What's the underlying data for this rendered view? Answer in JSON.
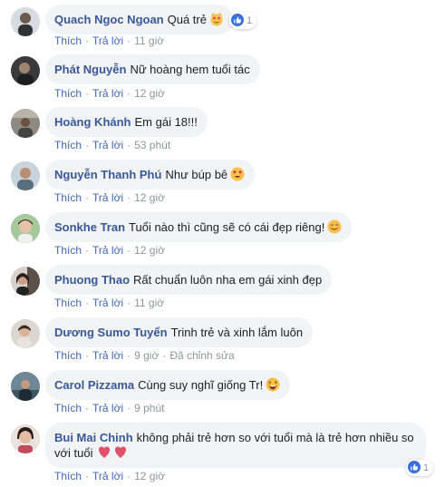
{
  "comments": [
    {
      "author": "Quach Ngoc Ngoan",
      "text": "Quá trẻ",
      "emoji": "cat-heart-eyes-icon",
      "reactions": "1",
      "like": "Thích",
      "reply": "Trả lời",
      "time": "11 giờ"
    },
    {
      "author": "Phát Nguyễn",
      "text": "Nữ hoàng hem tuổi tác",
      "like": "Thích",
      "reply": "Trả lời",
      "time": "12 giờ"
    },
    {
      "author": "Hoàng Khánh",
      "text": "Em gái 18!!!",
      "like": "Thích",
      "reply": "Trả lời",
      "time": "53 phút"
    },
    {
      "author": "Nguyễn Thanh Phú",
      "text": "Như búp bê",
      "emoji": "heart-eyes-emoji-icon",
      "like": "Thích",
      "reply": "Trả lời",
      "time": "12 giờ"
    },
    {
      "author": "Sonkhe Tran",
      "text": "Tuổi nào thì cũng sẽ có cái đẹp riêng!",
      "emoji": "smile-emoji-icon",
      "like": "Thích",
      "reply": "Trả lời",
      "time": "12 giờ"
    },
    {
      "author": "Phuong Thao",
      "text": "Rất chuẩn luôn nha em gái xinh đẹp",
      "like": "Thích",
      "reply": "Trả lời",
      "time": "11 giờ"
    },
    {
      "author": "Dương Sumo Tuyển",
      "text": "Trinh trẻ và xinh lắm luôn",
      "like": "Thích",
      "reply": "Trả lời",
      "time": "9 giờ",
      "edited": "Đã chỉnh sửa"
    },
    {
      "author": "Carol Pizzama",
      "text": "Cùng suy nghĩ giống Tr!",
      "emoji": "laughing-emoji-icon",
      "like": "Thích",
      "reply": "Trả lời",
      "time": "9 phút"
    },
    {
      "author": "Bui Mai Chinh",
      "text_line1": "không phải trẻ hơn so với tuổi mà là trẻ hơn nhiều so",
      "text_line2": "với tuổi",
      "emoji": "two-hearts-icon",
      "reactions": "1",
      "like": "Thích",
      "reply": "Trả lời",
      "time": "12 giờ"
    }
  ],
  "colors": {
    "author": "#385898",
    "action": "#4267b2",
    "bubble": "#f2f3f5",
    "meta": "#90949c"
  }
}
